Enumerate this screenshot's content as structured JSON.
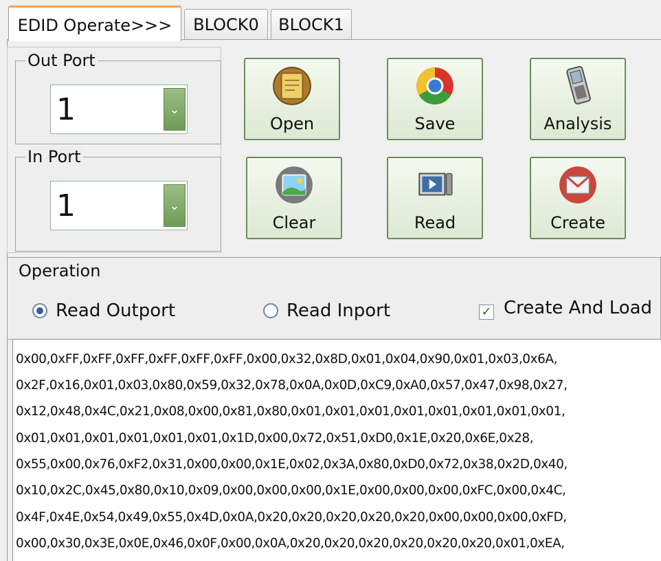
{
  "tabs": [
    {
      "label": "EDID Operate>>>",
      "active": true
    },
    {
      "label": "BLOCK0",
      "active": false
    },
    {
      "label": "BLOCK1",
      "active": false
    }
  ],
  "out_port": {
    "legend": "Out Port",
    "value": "1"
  },
  "in_port": {
    "legend": "In Port",
    "value": "1"
  },
  "buttons": {
    "open": {
      "label": "Open",
      "icon": "notebook-icon"
    },
    "save": {
      "label": "Save",
      "icon": "chrome-icon"
    },
    "analysis": {
      "label": "Analysis",
      "icon": "handheld-device-icon"
    },
    "clear": {
      "label": "Clear",
      "icon": "landscape-picture-icon"
    },
    "read": {
      "label": "Read",
      "icon": "media-player-icon"
    },
    "create": {
      "label": "Create",
      "icon": "mail-icon"
    }
  },
  "operation": {
    "legend": "Operation",
    "read_outport": {
      "label": "Read Outport",
      "selected": true
    },
    "read_inport": {
      "label": "Read Inport",
      "selected": false
    },
    "create_and_load": {
      "label": "Create And Load",
      "checked": true
    }
  },
  "hex_lines": [
    "0x00,0xFF,0xFF,0xFF,0xFF,0xFF,0xFF,0x00,0x32,0x8D,0x01,0x04,0x90,0x01,0x03,0x6A,",
    "0x2F,0x16,0x01,0x03,0x80,0x59,0x32,0x78,0x0A,0x0D,0xC9,0xA0,0x57,0x47,0x98,0x27,",
    "0x12,0x48,0x4C,0x21,0x08,0x00,0x81,0x80,0x01,0x01,0x01,0x01,0x01,0x01,0x01,0x01,",
    "0x01,0x01,0x01,0x01,0x01,0x01,0x1D,0x00,0x72,0x51,0xD0,0x1E,0x20,0x6E,0x28,",
    "0x55,0x00,0x76,0xF2,0x31,0x00,0x00,0x1E,0x02,0x3A,0x80,0xD0,0x72,0x38,0x2D,0x40,",
    "0x10,0x2C,0x45,0x80,0x10,0x09,0x00,0x00,0x00,0x1E,0x00,0x00,0x00,0xFC,0x00,0x4C,",
    "0x4F,0x4E,0x54,0x49,0x55,0x4D,0x0A,0x20,0x20,0x20,0x20,0x20,0x00,0x00,0x00,0xFD,",
    "0x00,0x30,0x3E,0x0E,0x46,0x0F,0x00,0x0A,0x20,0x20,0x20,0x20,0x20,0x20,0x01,0xEA,"
  ]
}
